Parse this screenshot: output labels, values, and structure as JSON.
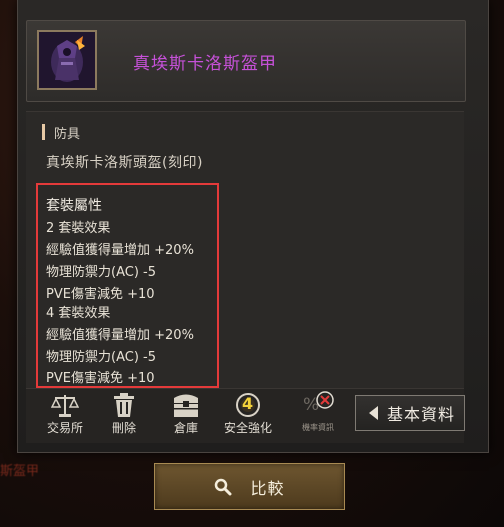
{
  "item": {
    "name": "真埃斯卡洛斯盔甲",
    "category": "防具",
    "sub_name": "真埃斯卡洛斯頭盔(刻印)"
  },
  "set_attributes": {
    "title": "套裝屬性",
    "lines": [
      "2 套裝效果",
      "經驗值獲得量增加 +20%",
      "物理防禦力(AC) -5",
      "PVE傷害減免 +10",
      "4 套裝效果",
      "經驗值獲得量增加 +20%",
      "物理防禦力(AC) -5",
      "PVE傷害減免 +10"
    ]
  },
  "toolbar": {
    "trade_label": "交易所",
    "delete_label": "刪除",
    "warehouse_label": "倉庫",
    "safe_enhance_label": "安全強化",
    "safe_enhance_badge": "4",
    "probability_label": "機率資訊",
    "basic_info_label": "基本資料"
  },
  "compare_button": {
    "label": "比較"
  },
  "background": {
    "fragment": "斯盔甲"
  },
  "colors": {
    "item_name": "#c651d8",
    "highlight_border": "#e43a3a",
    "compare_button": "#5d4727"
  }
}
